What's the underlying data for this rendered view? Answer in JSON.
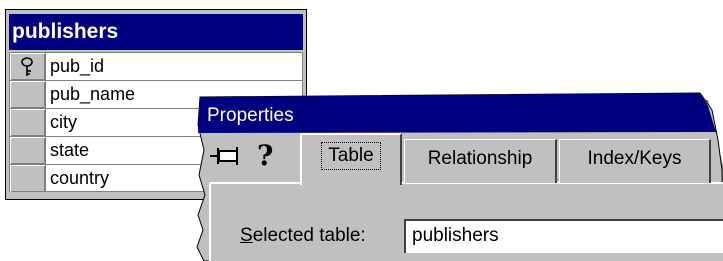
{
  "table_window": {
    "title": "publishers",
    "columns": [
      {
        "name": "pub_id",
        "is_key": true
      },
      {
        "name": "pub_name",
        "is_key": false
      },
      {
        "name": "city",
        "is_key": false
      },
      {
        "name": "state",
        "is_key": false
      },
      {
        "name": "country",
        "is_key": false
      }
    ]
  },
  "properties": {
    "title": "Properties",
    "toolbar": {
      "pin_icon": "pushpin-icon",
      "help_icon": "help-icon"
    },
    "tabs": [
      {
        "label": "Table",
        "active": true
      },
      {
        "label": "Relationship",
        "active": false
      },
      {
        "label": "Index/Keys",
        "active": false
      }
    ],
    "selected_table_label_underlined": "S",
    "selected_table_label_rest": "elected table:",
    "selected_table_value": "publishers"
  },
  "colors": {
    "title_bar": "#000080",
    "face": "#c0c0c0"
  }
}
